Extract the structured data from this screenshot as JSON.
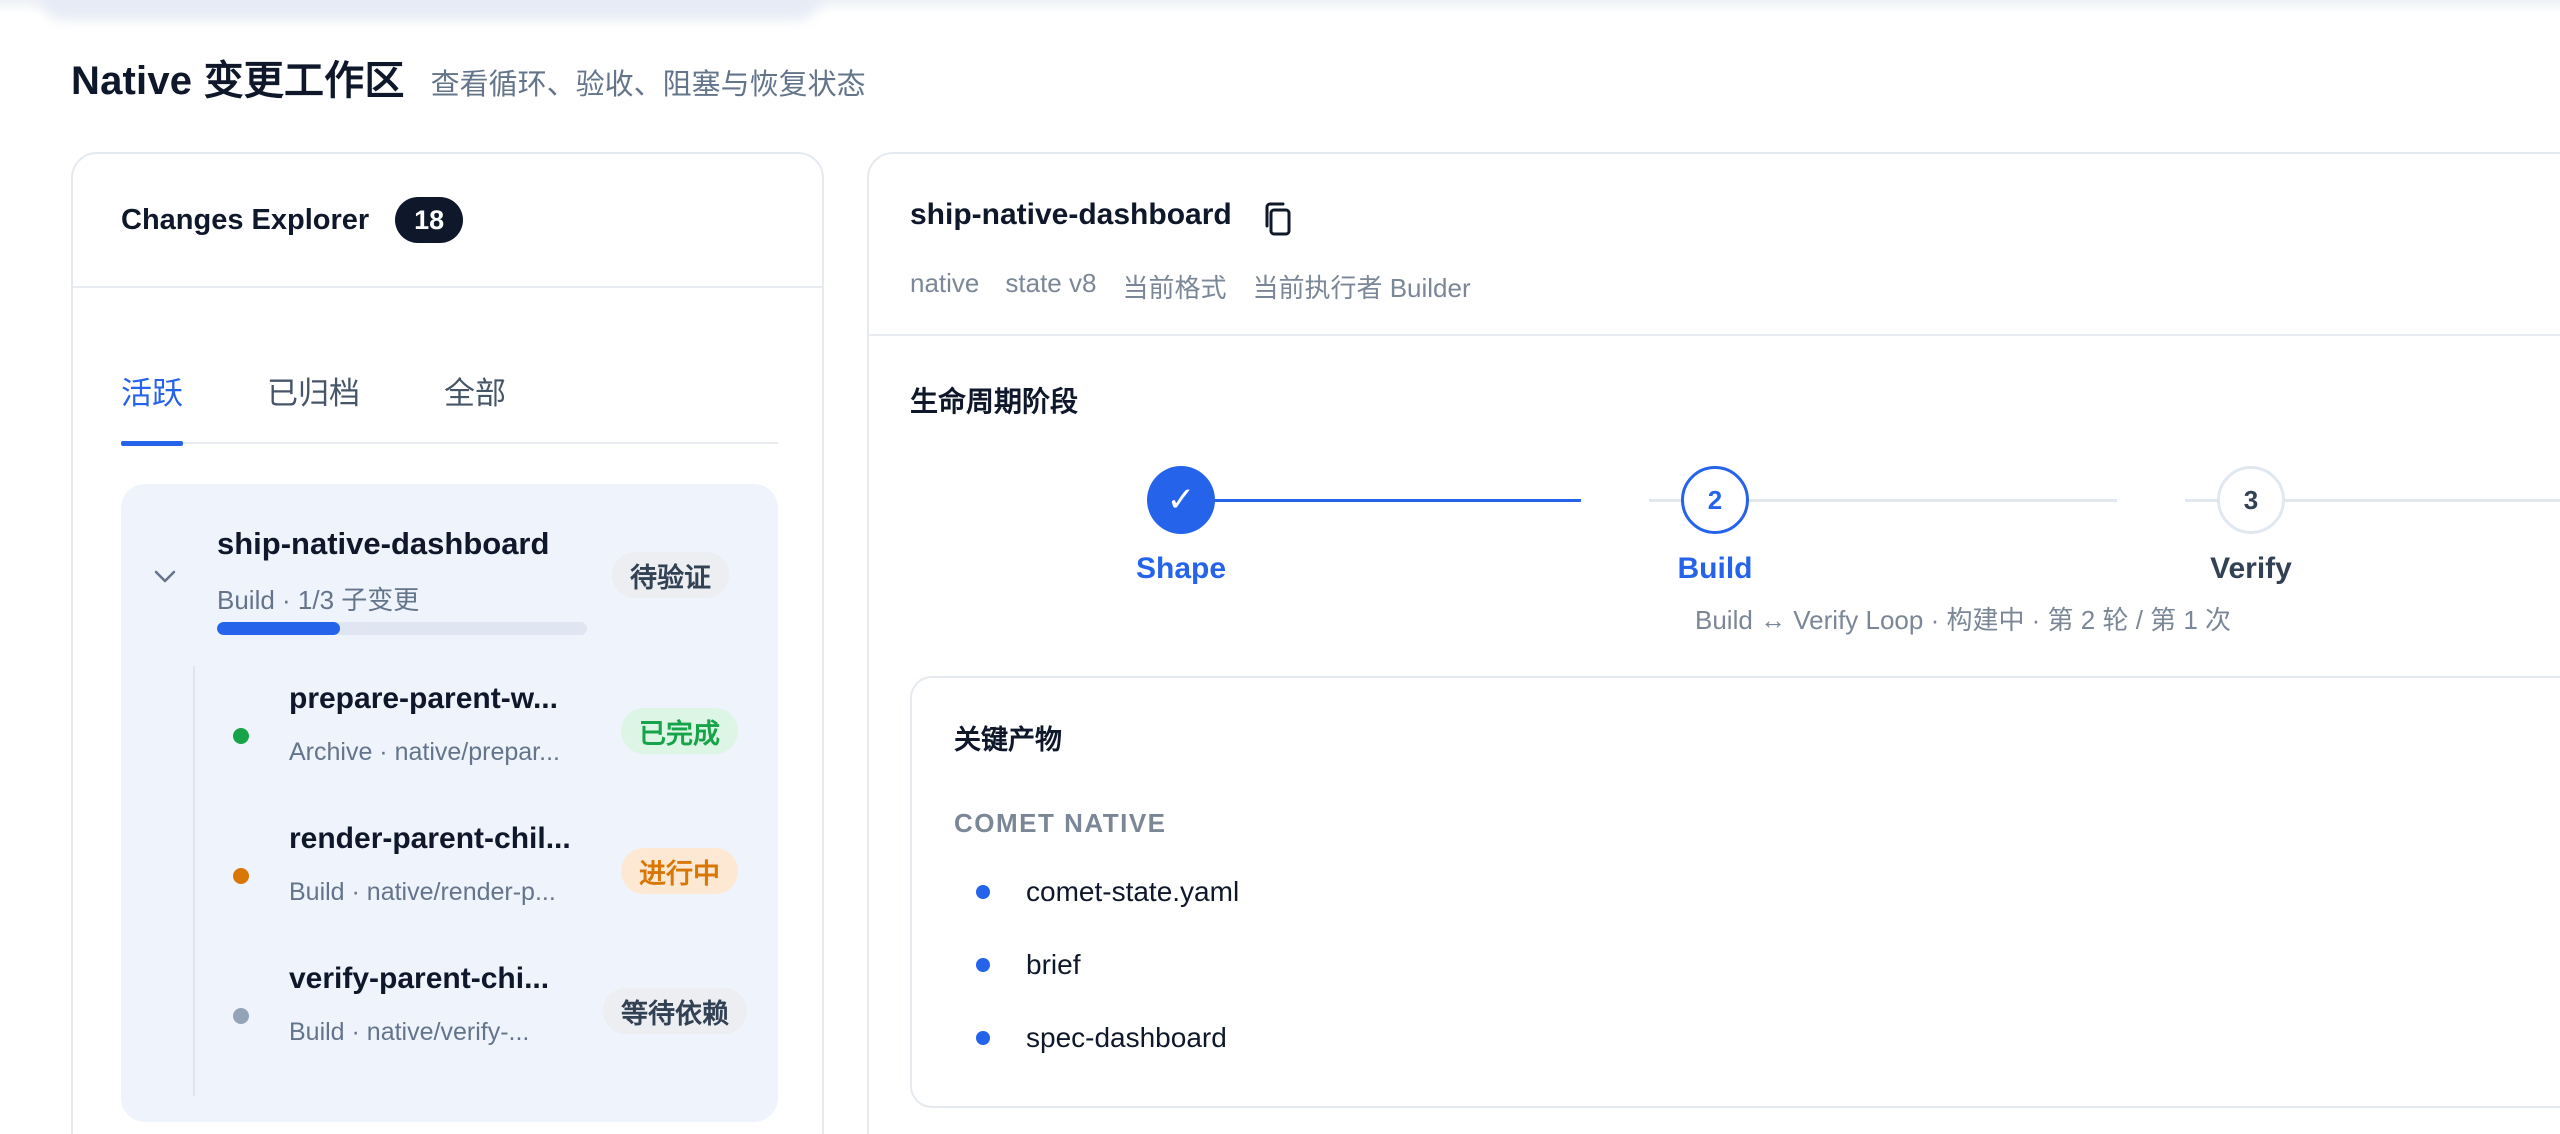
{
  "page": {
    "title": "Native 变更工作区",
    "subtitle": "查看循环、验收、阻塞与恢复状态"
  },
  "explorer": {
    "title": "Changes Explorer",
    "count": "18",
    "tabs": [
      {
        "label": "活跃",
        "active": true
      },
      {
        "label": "已归档",
        "active": false
      },
      {
        "label": "全部",
        "active": false
      }
    ],
    "group": {
      "name": "ship-native-dashboard",
      "meta": "Build · 1/3 子变更",
      "progress_fraction": 0.333,
      "status": "待验证",
      "children": [
        {
          "name": "prepare-parent-w...",
          "sub": "Archive · native/prepar...",
          "status": "已完成",
          "status_kind": "done",
          "dot_color": "#16a34a"
        },
        {
          "name": "render-parent-chil...",
          "sub": "Build · native/render-p...",
          "status": "进行中",
          "status_kind": "progress",
          "dot_color": "#d97706"
        },
        {
          "name": "verify-parent-chi...",
          "sub": "Build · native/verify-...",
          "status": "等待依赖",
          "status_kind": "neutral",
          "dot_color": "#94a3b8"
        }
      ]
    }
  },
  "detail": {
    "title": "ship-native-dashboard",
    "meta": [
      "native",
      "state v8",
      "当前格式",
      "当前执行者 Builder"
    ],
    "lifecycle_title": "生命周期阶段",
    "steps": [
      {
        "label": "Shape",
        "marker": "✓",
        "state": "done"
      },
      {
        "label": "Build",
        "marker": "2",
        "state": "current"
      },
      {
        "label": "Verify",
        "marker": "3",
        "state": "todo"
      }
    ],
    "loop_note": "Build ↔ Verify Loop · 构建中 · 第 2 轮 / 第 1 次",
    "artifacts": {
      "title": "关键产物",
      "group_label": "COMET NATIVE",
      "items": [
        "comet-state.yaml",
        "brief",
        "spec-dashboard"
      ]
    }
  },
  "colors": {
    "accent": "#2563eb",
    "done": "#16a34a",
    "progress": "#d97706"
  }
}
